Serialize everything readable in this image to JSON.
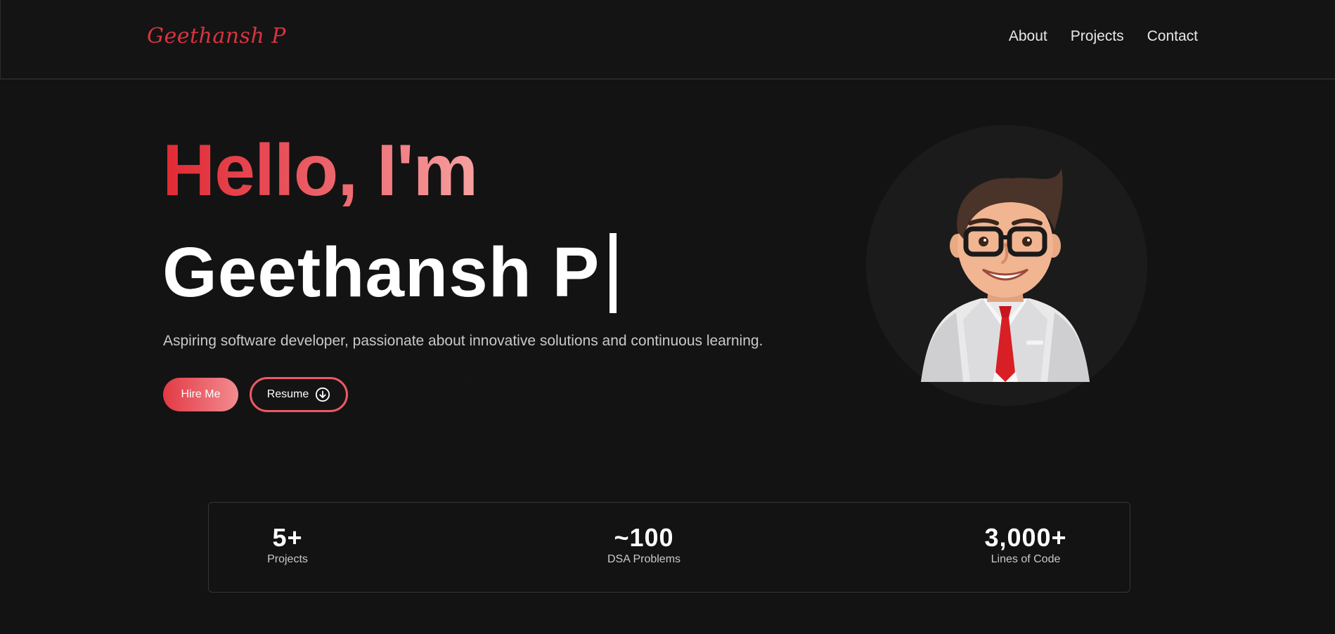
{
  "header": {
    "logo": "Geethansh P",
    "nav": [
      "About",
      "Projects",
      "Contact"
    ]
  },
  "hero": {
    "greeting": "Hello, I'm",
    "name": "Geethansh P",
    "tagline": "Aspiring software developer, passionate about innovative solutions and continuous learning.",
    "hire_label": "Hire Me",
    "resume_label": "Resume"
  },
  "stats": [
    {
      "value": "5+",
      "label": "Projects"
    },
    {
      "value": "~100",
      "label": "DSA Problems"
    },
    {
      "value": "3,000+",
      "label": "Lines of Code"
    }
  ],
  "colors": {
    "accent": "#e02a33",
    "accent_light": "#f28c90",
    "background": "#131314"
  },
  "icons": {
    "resume_icon": "download-circle-icon"
  }
}
